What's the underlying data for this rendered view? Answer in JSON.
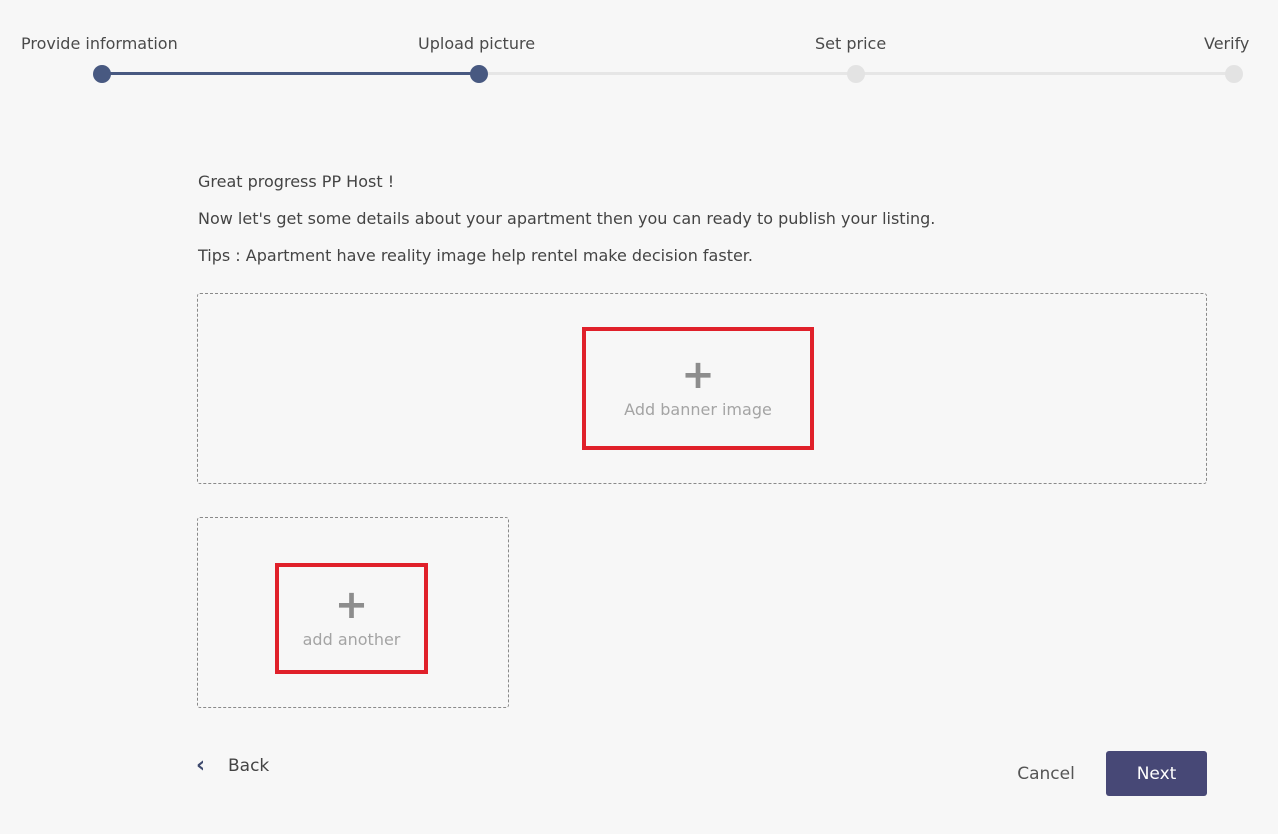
{
  "stepper": {
    "steps": [
      {
        "label": "Provide information",
        "state": "done"
      },
      {
        "label": "Upload picture",
        "state": "current"
      },
      {
        "label": "Set price",
        "state": "todo"
      },
      {
        "label": "Verify",
        "state": "todo"
      }
    ],
    "colors": {
      "done": "#485981",
      "todo": "#e3e3e3"
    }
  },
  "intro": {
    "greeting": "Great progress PP Host !",
    "details": "Now let's get some details about your apartment then you can ready to publish your listing.",
    "tips": "Tips : Apartment have reality image help rentel make decision faster."
  },
  "upload": {
    "banner": {
      "icon": "plus-icon",
      "label": "Add banner image"
    },
    "another": {
      "icon": "plus-icon",
      "label": "add another"
    },
    "highlight_color": "#e0202a"
  },
  "actions": {
    "back_label": "Back",
    "back_icon": "chevron-left-icon",
    "cancel_label": "Cancel",
    "next_label": "Next",
    "next_color": "#474876"
  }
}
